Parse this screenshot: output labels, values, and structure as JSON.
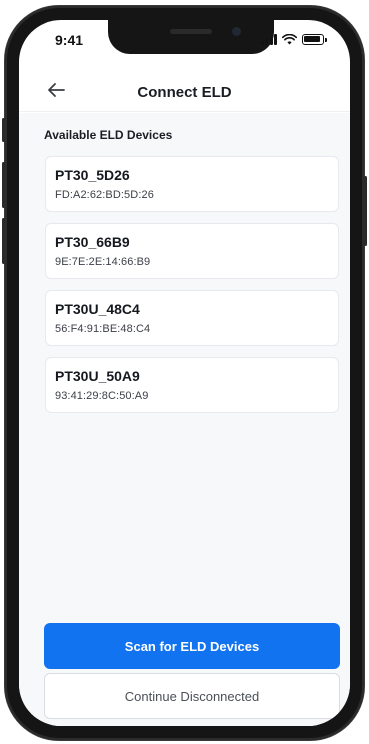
{
  "status_bar": {
    "time": "9:41"
  },
  "header": {
    "title": "Connect ELD",
    "back_icon": "arrow-left-icon"
  },
  "section": {
    "label": "Available ELD Devices"
  },
  "devices": [
    {
      "name": "PT30_5D26",
      "mac": "FD:A2:62:BD:5D:26"
    },
    {
      "name": "PT30_66B9",
      "mac": "9E:7E:2E:14:66:B9"
    },
    {
      "name": "PT30U_48C4",
      "mac": "56:F4:91:BE:48:C4"
    },
    {
      "name": "PT30U_50A9",
      "mac": "93:41:29:8C:50:A9"
    }
  ],
  "actions": {
    "scan_label": "Scan for ELD Devices",
    "continue_label": "Continue Disconnected"
  },
  "colors": {
    "accent": "#1273f0",
    "background": "#f7f8fa"
  }
}
